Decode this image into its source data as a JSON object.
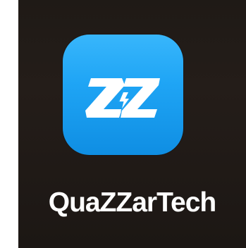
{
  "home_screen": {
    "app": {
      "label": "QuaZZarTech",
      "icon_name": "zz-lightning-logo-icon",
      "icon_colors": {
        "gradient_top": "#38b6fb",
        "gradient_bottom": "#0f8ee3",
        "glyph": "#ffffff"
      }
    },
    "background_color": "#1f1a16"
  }
}
